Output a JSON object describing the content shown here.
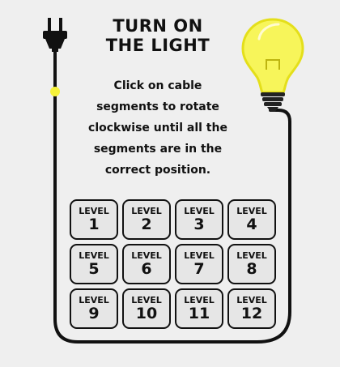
{
  "title": {
    "line1": "TURN ON",
    "line2": "THE LIGHT"
  },
  "instructions": "Click on cable segments to rotate clockwise until all the segments are in the correct position.",
  "levels": [
    {
      "label": "LEVEL",
      "number": "1"
    },
    {
      "label": "LEVEL",
      "number": "2"
    },
    {
      "label": "LEVEL",
      "number": "3"
    },
    {
      "label": "LEVEL",
      "number": "4"
    },
    {
      "label": "LEVEL",
      "number": "5"
    },
    {
      "label": "LEVEL",
      "number": "6"
    },
    {
      "label": "LEVEL",
      "number": "7"
    },
    {
      "label": "LEVEL",
      "number": "8"
    },
    {
      "label": "LEVEL",
      "number": "9"
    },
    {
      "label": "LEVEL",
      "number": "10"
    },
    {
      "label": "LEVEL",
      "number": "11"
    },
    {
      "label": "LEVEL",
      "number": "12"
    }
  ],
  "icons": {
    "plug": "plug-icon",
    "bulb": "light-bulb-icon",
    "cable": "cable",
    "spark": "spark-dot"
  },
  "colors": {
    "background": "#efefef",
    "cable": "#111111",
    "bulb_glow": "#f4f24a",
    "spark": "#f6f33a",
    "button_bg": "#e6e6e6"
  }
}
